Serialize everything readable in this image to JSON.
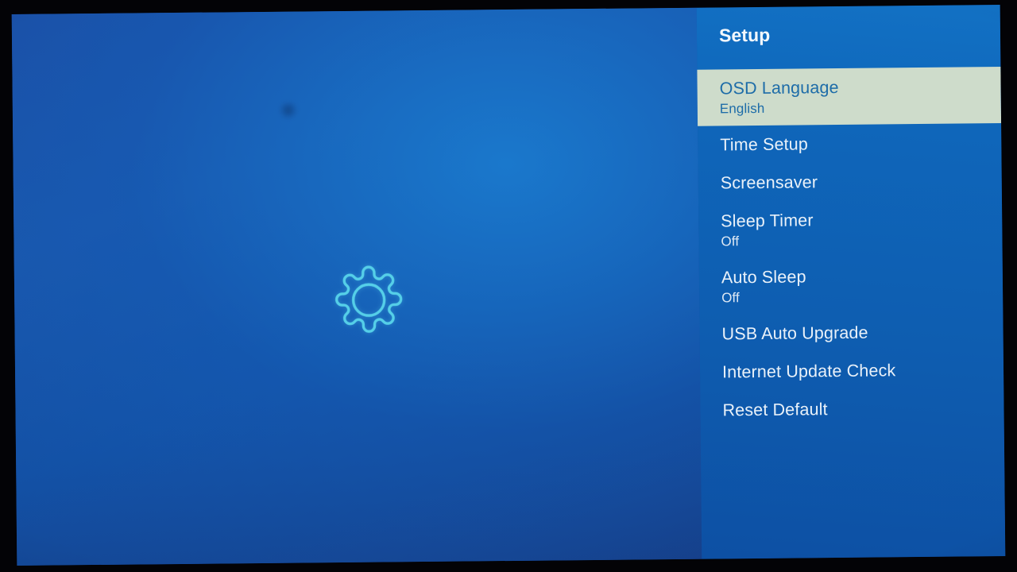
{
  "device_screen": {
    "background_color": "#1348a0",
    "accent_icon_color": "#55cfe8",
    "highlight_color": "#cedccb",
    "highlight_text_color": "#1d6ca8",
    "menu_text_color": "#e9f1f9"
  },
  "hero": {
    "icon": "gear-icon"
  },
  "menu": {
    "title": "Setup",
    "items": [
      {
        "label": "OSD Language",
        "value": "English",
        "selected": true
      },
      {
        "label": "Time Setup",
        "value": "",
        "selected": false
      },
      {
        "label": "Screensaver",
        "value": "",
        "selected": false
      },
      {
        "label": "Sleep Timer",
        "value": "Off",
        "selected": false
      },
      {
        "label": "Auto Sleep",
        "value": "Off",
        "selected": false
      },
      {
        "label": "USB Auto Upgrade",
        "value": "",
        "selected": false
      },
      {
        "label": "Internet Update Check",
        "value": "",
        "selected": false
      },
      {
        "label": "Reset Default",
        "value": "",
        "selected": false
      }
    ]
  }
}
